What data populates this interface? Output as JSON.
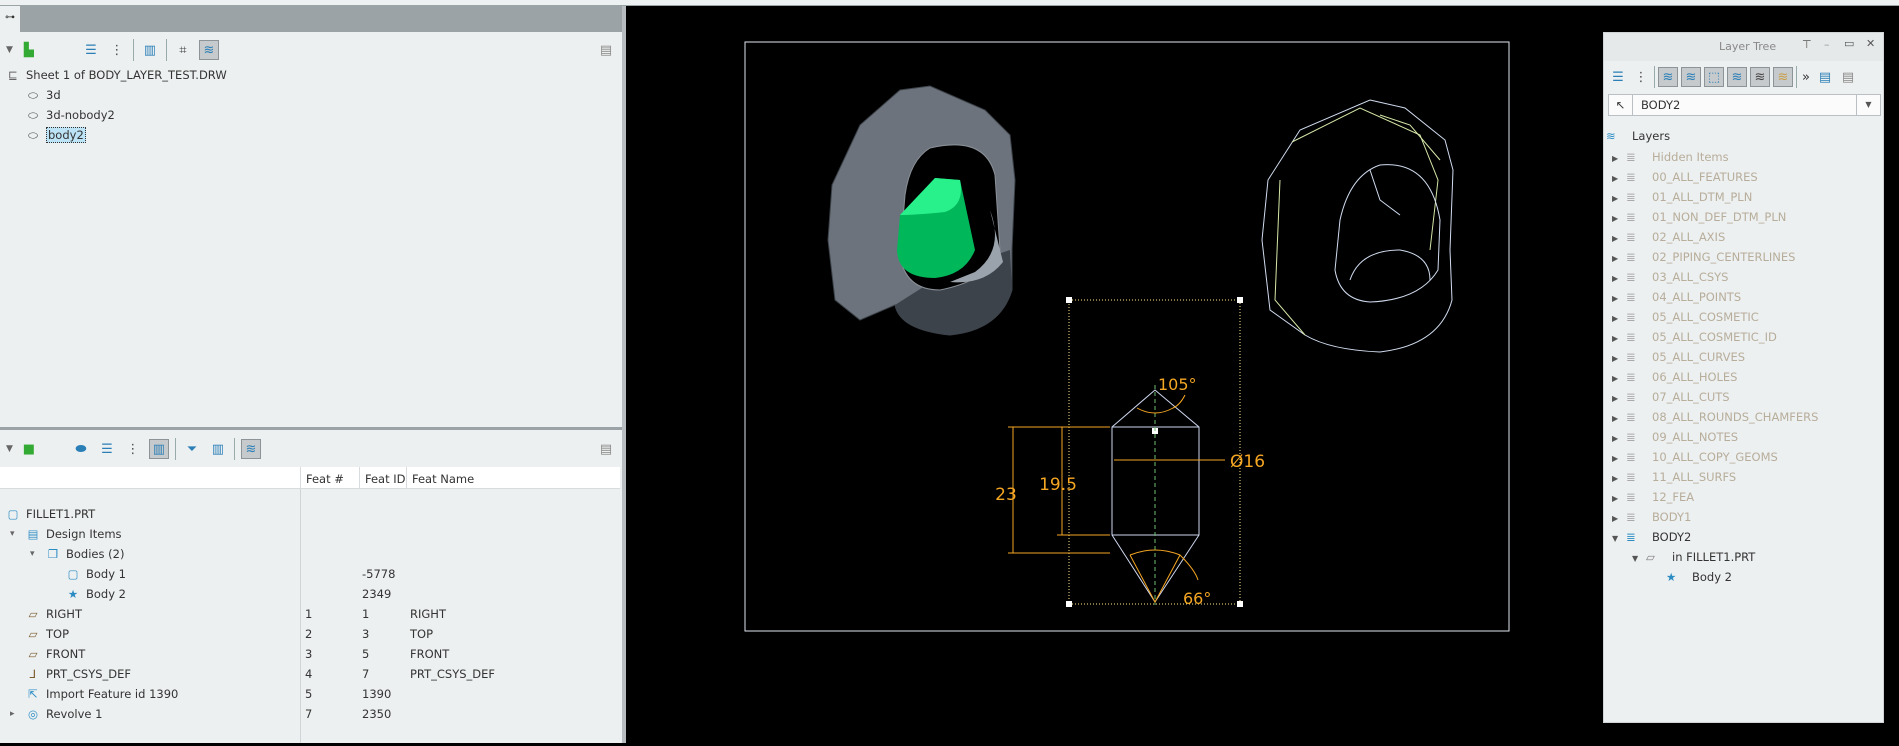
{
  "model_tree": {
    "tab_icon": "model-tree-icon",
    "sheet": "Sheet 1 of BODY_LAYER_TEST.DRW",
    "views": [
      {
        "label": "3d"
      },
      {
        "label": "3d-nobody2"
      },
      {
        "label": "body2",
        "selected": true
      }
    ]
  },
  "feature_tree": {
    "columns": [
      "Feat #",
      "Feat ID",
      "Feat Name"
    ],
    "rows": [
      {
        "label": "FILLET1.PRT",
        "icon": "part-icon",
        "level": 0,
        "feat_no": "",
        "feat_id": "",
        "feat_name": ""
      },
      {
        "label": "Design Items",
        "icon": "design-items-icon",
        "level": 1,
        "expanded": true,
        "feat_no": "",
        "feat_id": "",
        "feat_name": ""
      },
      {
        "label": "Bodies (2)",
        "icon": "bodies-icon",
        "level": 2,
        "expanded": true,
        "feat_no": "",
        "feat_id": "",
        "feat_name": ""
      },
      {
        "label": "Body 1",
        "icon": "body-icon",
        "level": 3,
        "feat_no": "",
        "feat_id": "-5778",
        "feat_name": ""
      },
      {
        "label": "Body 2",
        "icon": "default-body-icon",
        "level": 3,
        "feat_no": "",
        "feat_id": "2349",
        "feat_name": ""
      },
      {
        "label": "RIGHT",
        "icon": "datum-plane-icon",
        "level": 1,
        "feat_no": "1",
        "feat_id": "1",
        "feat_name": "RIGHT"
      },
      {
        "label": "TOP",
        "icon": "datum-plane-icon",
        "level": 1,
        "feat_no": "2",
        "feat_id": "3",
        "feat_name": "TOP"
      },
      {
        "label": "FRONT",
        "icon": "datum-plane-icon",
        "level": 1,
        "feat_no": "3",
        "feat_id": "5",
        "feat_name": "FRONT"
      },
      {
        "label": "PRT_CSYS_DEF",
        "icon": "csys-icon",
        "level": 1,
        "feat_no": "4",
        "feat_id": "7",
        "feat_name": "PRT_CSYS_DEF"
      },
      {
        "label": "Import Feature id 1390",
        "icon": "import-feature-icon",
        "level": 1,
        "feat_no": "5",
        "feat_id": "1390",
        "feat_name": ""
      },
      {
        "label": "Revolve 1",
        "icon": "revolve-icon",
        "level": 1,
        "collapsed": true,
        "feat_no": "7",
        "feat_id": "2350",
        "feat_name": ""
      }
    ]
  },
  "drawing": {
    "dims": {
      "d23": "23",
      "d195": "19.5",
      "dia": "Ø16",
      "a105": "105°",
      "a66": "66°"
    },
    "colors": {
      "dimension": "#f5a623",
      "shaded_body": "#00d86a",
      "frame": "#e0e6f0"
    }
  },
  "layer_tree": {
    "title": "Layer Tree",
    "selector_value": "BODY2",
    "root": "Layers",
    "layers": [
      {
        "label": "Hidden Items"
      },
      {
        "label": "00_ALL_FEATURES"
      },
      {
        "label": "01_ALL_DTM_PLN"
      },
      {
        "label": "01_NON_DEF_DTM_PLN"
      },
      {
        "label": "02_ALL_AXIS"
      },
      {
        "label": "02_PIPING_CENTERLINES"
      },
      {
        "label": "03_ALL_CSYS"
      },
      {
        "label": "04_ALL_POINTS"
      },
      {
        "label": "05_ALL_COSMETIC"
      },
      {
        "label": "05_ALL_COSMETIC_ID"
      },
      {
        "label": "05_ALL_CURVES"
      },
      {
        "label": "06_ALL_HOLES"
      },
      {
        "label": "07_ALL_CUTS"
      },
      {
        "label": "08_ALL_ROUNDS_CHAMFERS"
      },
      {
        "label": "09_ALL_NOTES"
      },
      {
        "label": "10_ALL_COPY_GEOMS"
      },
      {
        "label": "11_ALL_SURFS"
      },
      {
        "label": "12_FEA"
      },
      {
        "label": "BODY1"
      },
      {
        "label": "BODY2",
        "active": true
      }
    ],
    "body2_children": {
      "part": "in FILLET1.PRT",
      "body": "Body 2"
    }
  }
}
